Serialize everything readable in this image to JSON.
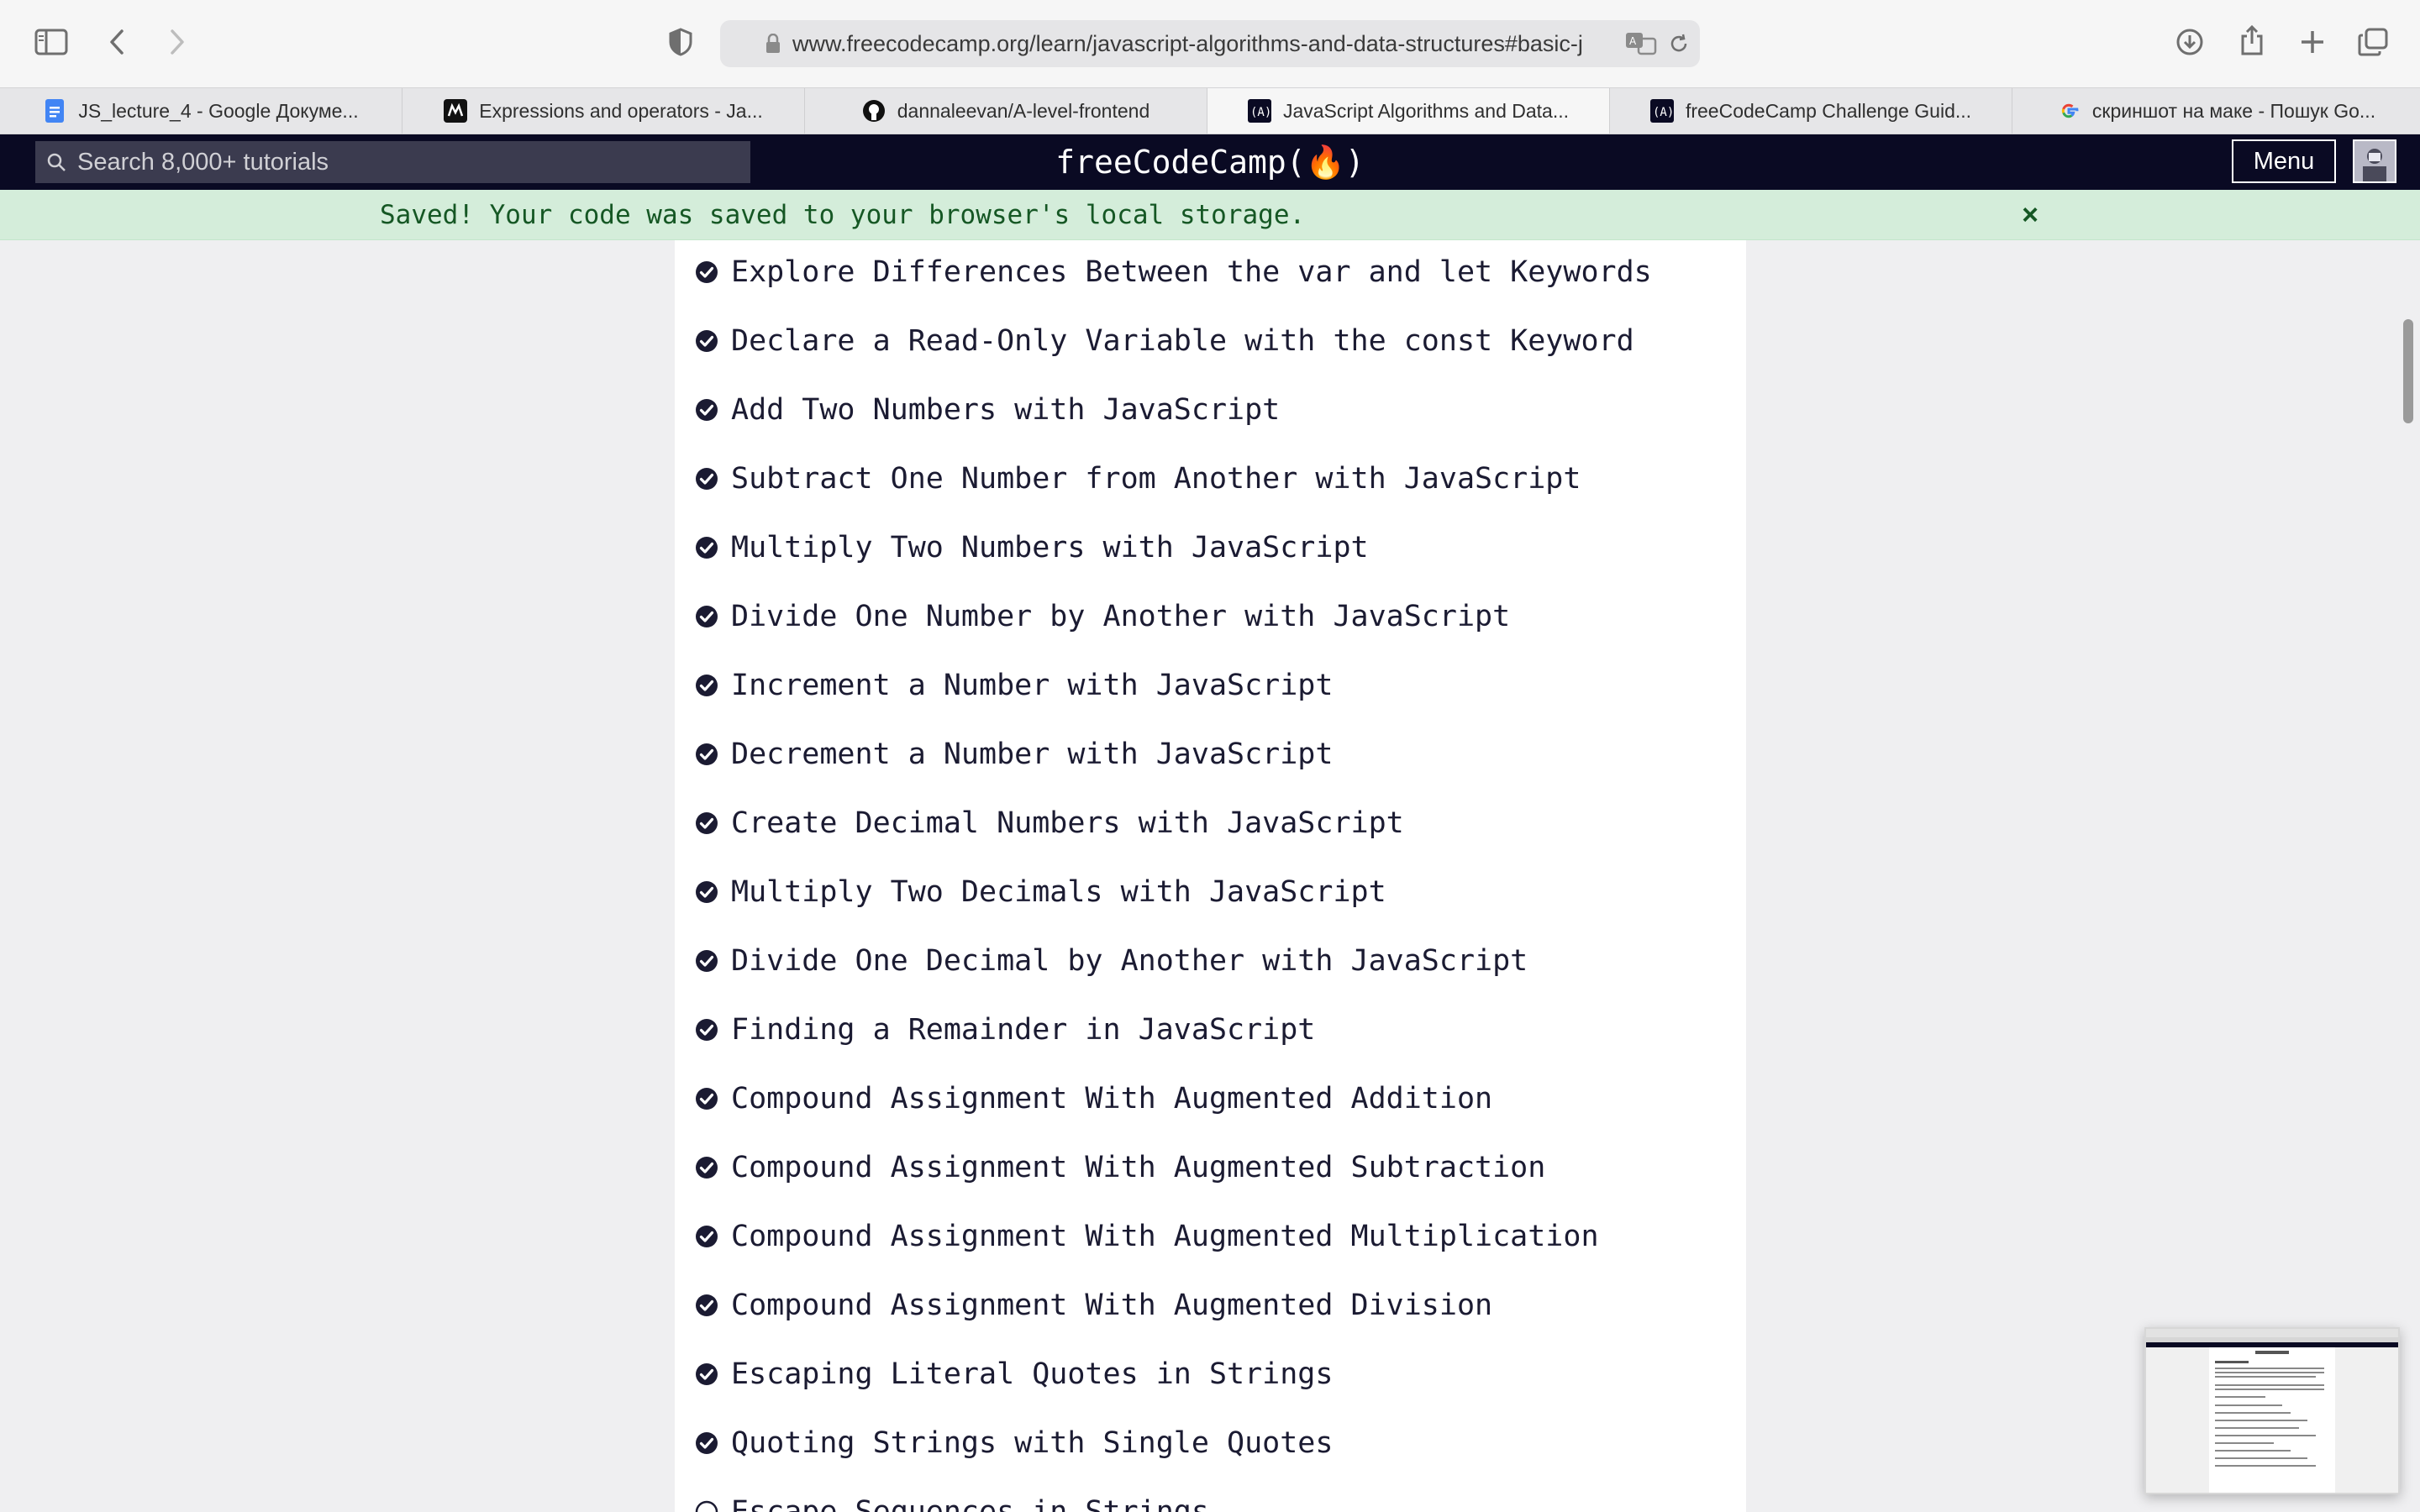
{
  "browser": {
    "url": "www.freecodecamp.org/learn/javascript-algorithms-and-data-structures#basic-j"
  },
  "tabs": [
    {
      "label": "JS_lecture_4 - Google Докуме...",
      "icon": "google-docs-icon",
      "active": false
    },
    {
      "label": "Expressions and operators - Ja...",
      "icon": "mdn-icon",
      "active": false
    },
    {
      "label": "dannaleevan/A-level-frontend",
      "icon": "github-icon",
      "active": false
    },
    {
      "label": "JavaScript Algorithms and Data...",
      "icon": "freecodecamp-icon",
      "active": true
    },
    {
      "label": "freeCodeCamp Challenge Guid...",
      "icon": "freecodecamp-icon",
      "active": false
    },
    {
      "label": "скриншот на маке - Пошук Go...",
      "icon": "google-icon",
      "active": false
    }
  ],
  "nav": {
    "search_placeholder": "Search 8,000+ tutorials",
    "brand": "freeCodeCamp(🔥)",
    "menu_label": "Menu"
  },
  "alert": {
    "text": "Saved! Your code was saved to your browser's local storage.",
    "close": "×"
  },
  "challenges": [
    {
      "title": "Explore Differences Between the var and let Keywords",
      "completed": true
    },
    {
      "title": "Declare a Read-Only Variable with the const Keyword",
      "completed": true
    },
    {
      "title": "Add Two Numbers with JavaScript",
      "completed": true
    },
    {
      "title": "Subtract One Number from Another with JavaScript",
      "completed": true
    },
    {
      "title": "Multiply Two Numbers with JavaScript",
      "completed": true
    },
    {
      "title": "Divide One Number by Another with JavaScript",
      "completed": true
    },
    {
      "title": "Increment a Number with JavaScript",
      "completed": true
    },
    {
      "title": "Decrement a Number with JavaScript",
      "completed": true
    },
    {
      "title": "Create Decimal Numbers with JavaScript",
      "completed": true
    },
    {
      "title": "Multiply Two Decimals with JavaScript",
      "completed": true
    },
    {
      "title": "Divide One Decimal by Another with JavaScript",
      "completed": true
    },
    {
      "title": "Finding a Remainder in JavaScript",
      "completed": true
    },
    {
      "title": "Compound Assignment With Augmented Addition",
      "completed": true
    },
    {
      "title": "Compound Assignment With Augmented Subtraction",
      "completed": true
    },
    {
      "title": "Compound Assignment With Augmented Multiplication",
      "completed": true
    },
    {
      "title": "Compound Assignment With Augmented Division",
      "completed": true
    },
    {
      "title": "Escaping Literal Quotes in Strings",
      "completed": true
    },
    {
      "title": "Quoting Strings with Single Quotes",
      "completed": true
    },
    {
      "title": "Escape Sequences in Strings",
      "completed": false
    }
  ],
  "colors": {
    "nav_bg": "#0a0a23",
    "alert_bg": "#d4edda",
    "alert_text": "#155724",
    "text": "#1b1b32"
  }
}
